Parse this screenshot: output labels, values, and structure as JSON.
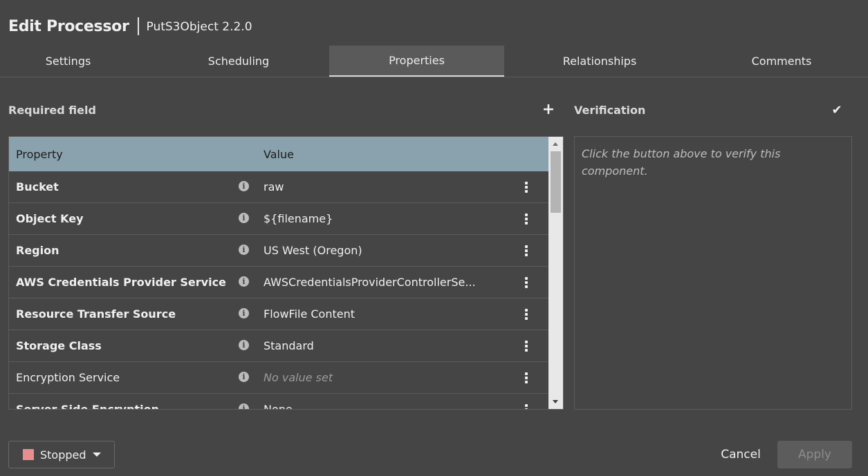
{
  "dialog": {
    "title": "Edit Processor",
    "subtitle": "PutS3Object 2.2.0"
  },
  "tabs": [
    {
      "label": "Settings",
      "active": false
    },
    {
      "label": "Scheduling",
      "active": false
    },
    {
      "label": "Properties",
      "active": true
    },
    {
      "label": "Relationships",
      "active": false
    },
    {
      "label": "Comments",
      "active": false
    }
  ],
  "properties": {
    "section_label": "Required field",
    "add_icon": "plus-icon",
    "columns": {
      "property": "Property",
      "value": "Value"
    },
    "rows": [
      {
        "name": "Bucket",
        "required": true,
        "value": "raw",
        "empty": false
      },
      {
        "name": "Object Key",
        "required": true,
        "value": "${filename}",
        "empty": false
      },
      {
        "name": "Region",
        "required": true,
        "value": "US West (Oregon)",
        "empty": false
      },
      {
        "name": "AWS Credentials Provider Service",
        "required": true,
        "value": "AWSCredentialsProviderControllerSe...",
        "empty": false
      },
      {
        "name": "Resource Transfer Source",
        "required": true,
        "value": "FlowFile Content",
        "empty": false
      },
      {
        "name": "Storage Class",
        "required": true,
        "value": "Standard",
        "empty": false
      },
      {
        "name": "Encryption Service",
        "required": false,
        "value": "No value set",
        "empty": true
      },
      {
        "name": "Server Side Encryption",
        "required": true,
        "value": "None",
        "empty": false
      }
    ]
  },
  "verification": {
    "label": "Verification",
    "verify_icon": "checkmark-icon",
    "placeholder": "Click the button above to verify this component."
  },
  "footer": {
    "status_label": "Stopped",
    "status_color": "#e88e8e",
    "cancel_label": "Cancel",
    "apply_label": "Apply"
  },
  "colors": {
    "background": "#454545",
    "table_header": "#8aa2ad",
    "active_tab": "#5a5a5a"
  }
}
